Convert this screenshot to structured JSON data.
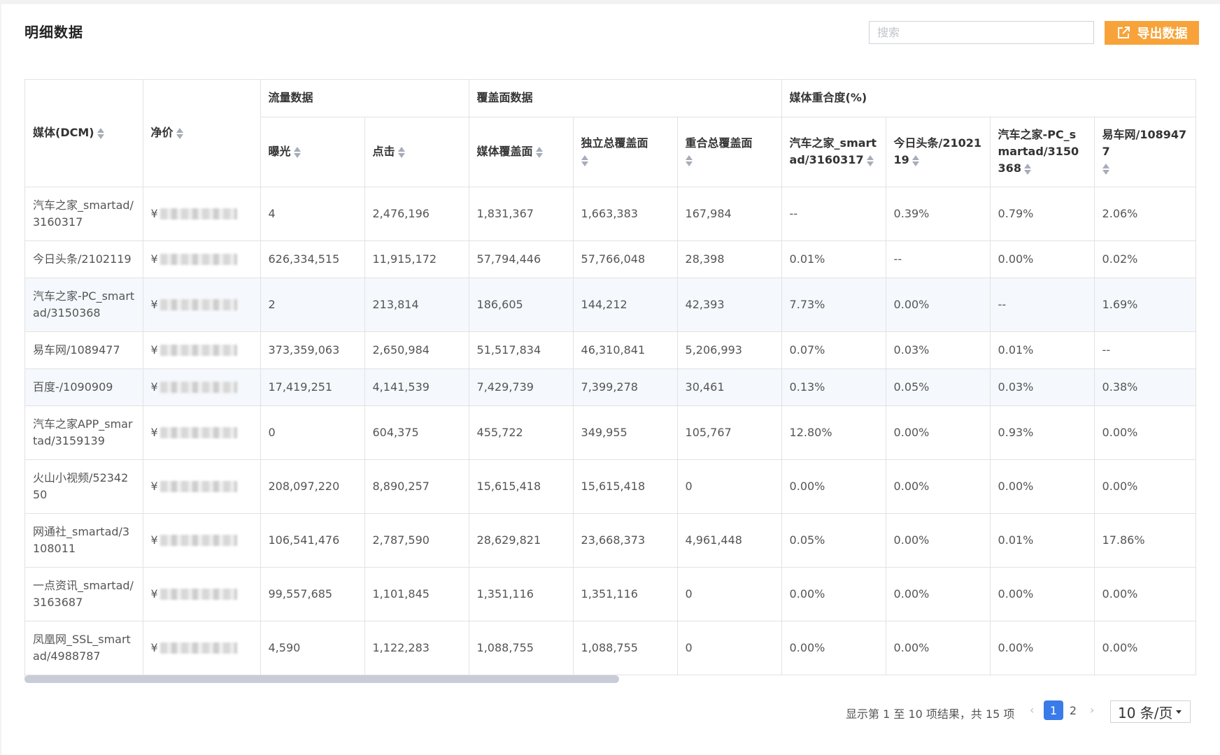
{
  "header": {
    "title": "明细数据",
    "search_placeholder": "搜索",
    "export_label": "导出数据"
  },
  "table": {
    "columns": {
      "media": "媒体(DCM)",
      "price": "净价",
      "traffic_group": "流量数据",
      "coverage_group": "覆盖面数据",
      "overlap_group": "媒体重合度(%)",
      "impressions": "曝光",
      "clicks": "点击",
      "media_coverage": "媒体覆盖面",
      "unique_coverage": "独立总覆盖面",
      "overlap_coverage": "重合总覆盖面",
      "ov_autohome": "汽车之家_smartad/3160317",
      "ov_toutiao": "今日头条/2102119",
      "ov_autohome_pc": "汽车之家-PC_smartad/3150368",
      "ov_yiche": "易车网/1089477"
    },
    "price_prefix": "¥",
    "rows": [
      [
        "汽车之家_smartad/3160317",
        "4",
        "2,476,196",
        "1,831,367",
        "1,663,383",
        "167,984",
        "--",
        "0.39%",
        "0.79%",
        "2.06%"
      ],
      [
        "今日头条/2102119",
        "626,334,515",
        "11,915,172",
        "57,794,446",
        "57,766,048",
        "28,398",
        "0.01%",
        "--",
        "0.00%",
        "0.02%"
      ],
      [
        "汽车之家-PC_smartad/3150368",
        "2",
        "213,814",
        "186,605",
        "144,212",
        "42,393",
        "7.73%",
        "0.00%",
        "--",
        "1.69%"
      ],
      [
        "易车网/1089477",
        "373,359,063",
        "2,650,984",
        "51,517,834",
        "46,310,841",
        "5,206,993",
        "0.07%",
        "0.03%",
        "0.01%",
        "--"
      ],
      [
        "百度-/1090909",
        "17,419,251",
        "4,141,539",
        "7,429,739",
        "7,399,278",
        "30,461",
        "0.13%",
        "0.05%",
        "0.03%",
        "0.38%"
      ],
      [
        "汽车之家APP_smartad/3159139",
        "0",
        "604,375",
        "455,722",
        "349,955",
        "105,767",
        "12.80%",
        "0.00%",
        "0.93%",
        "0.00%"
      ],
      [
        "火山小视频/5234250",
        "208,097,220",
        "8,890,257",
        "15,615,418",
        "15,615,418",
        "0",
        "0.00%",
        "0.00%",
        "0.00%",
        "0.00%"
      ],
      [
        "网通社_smartad/3108011",
        "106,541,476",
        "2,787,590",
        "28,629,821",
        "23,668,373",
        "4,961,448",
        "0.05%",
        "0.00%",
        "0.01%",
        "17.86%"
      ],
      [
        "一点资讯_smartad/3163687",
        "99,557,685",
        "1,101,845",
        "1,351,116",
        "1,351,116",
        "0",
        "0.00%",
        "0.00%",
        "0.00%",
        "0.00%"
      ],
      [
        "凤凰网_SSL_smartad/4988787",
        "4,590",
        "1,122,283",
        "1,088,755",
        "1,088,755",
        "0",
        "0.00%",
        "0.00%",
        "0.00%",
        "0.00%"
      ]
    ]
  },
  "pagination": {
    "info": "显示第 1 至 10 项结果，共 15 项",
    "prev": "‹",
    "next": "›",
    "page1": "1",
    "page2": "2",
    "page_size": "10 条/页"
  }
}
